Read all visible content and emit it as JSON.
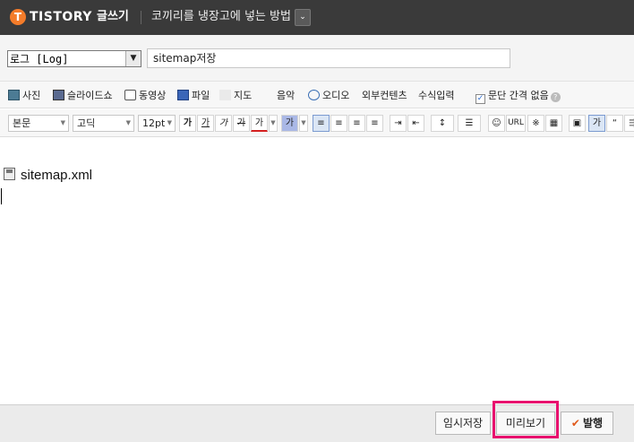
{
  "header": {
    "brand": "TISTORY",
    "brand_icon": "T",
    "mode": "글쓰기",
    "post_title": "코끼리를 냉장고에 넣는 방법",
    "dropdown_glyph": "⌄"
  },
  "meta": {
    "category": "로그 [Log]",
    "title_value": "sitemap저장"
  },
  "insert_toolbar": {
    "items": [
      {
        "label": "사진"
      },
      {
        "label": "슬라이드쇼"
      },
      {
        "label": "동영상"
      },
      {
        "label": "파일"
      },
      {
        "label": "지도"
      },
      {
        "label": "음악"
      },
      {
        "label": "오디오"
      },
      {
        "label": "외부컨텐츠"
      },
      {
        "label": "수식입력"
      }
    ],
    "paragraph_option": "문단 간격 없음",
    "paragraph_checked": true
  },
  "format_toolbar": {
    "style": "본문",
    "font": "고딕",
    "size": "12pt",
    "url_label": "URL",
    "text_buttons": [
      "가",
      "가",
      "가",
      "가",
      "가",
      "가"
    ]
  },
  "editor": {
    "content": "sitemap.xml"
  },
  "footer": {
    "save_label": "임시저장",
    "preview_label": "미리보기",
    "publish_label": "발행",
    "publish_mark": "✔"
  },
  "colors": {
    "header_bg": "#3a3a3a",
    "brand_orange": "#f47c2a",
    "highlight": "#e8106e"
  }
}
